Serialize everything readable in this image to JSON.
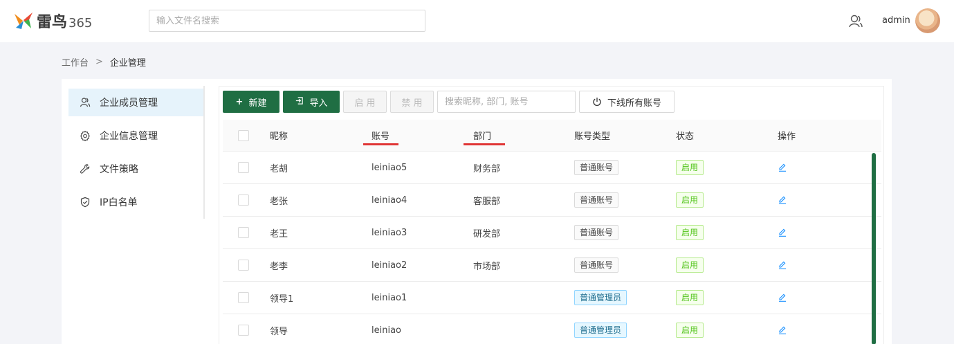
{
  "header": {
    "logo_text": "雷鸟",
    "logo_num": "365",
    "search_placeholder": "输入文件名搜索",
    "username": "admin"
  },
  "breadcrumb": {
    "home": "工作台",
    "separator": ">",
    "current": "企业管理"
  },
  "sidebar": {
    "items": [
      {
        "label": "企业成员管理",
        "icon": "users-icon",
        "active": true
      },
      {
        "label": "企业信息管理",
        "icon": "gear-icon",
        "active": false
      },
      {
        "label": "文件策略",
        "icon": "wrench-icon",
        "active": false
      },
      {
        "label": "IP白名单",
        "icon": "shield-icon",
        "active": false
      }
    ]
  },
  "toolbar": {
    "new_label": "新建",
    "new_icon": "plus-icon",
    "import_label": "导入",
    "import_icon": "import-icon",
    "enable_label": "启 用",
    "disable_label": "禁 用",
    "search_placeholder": "搜索昵称, 部门, 账号",
    "offline_label": "下线所有账号",
    "offline_icon": "power-icon"
  },
  "table": {
    "headers": {
      "nickname": "昵称",
      "account": "账号",
      "department": "部门",
      "account_type": "账号类型",
      "status": "状态",
      "action": "操作"
    },
    "rows": [
      {
        "nickname": "老胡",
        "account": "leiniao5",
        "department": "财务部",
        "account_type": "普通账号",
        "status": "启用"
      },
      {
        "nickname": "老张",
        "account": "leiniao4",
        "department": "客服部",
        "account_type": "普通账号",
        "status": "启用"
      },
      {
        "nickname": "老王",
        "account": "leiniao3",
        "department": "研发部",
        "account_type": "普通账号",
        "status": "启用"
      },
      {
        "nickname": "老李",
        "account": "leiniao2",
        "department": "市场部",
        "account_type": "普通账号",
        "status": "启用"
      },
      {
        "nickname": "领导1",
        "account": "leiniao1",
        "department": "",
        "account_type": "普通管理员",
        "status": "启用"
      },
      {
        "nickname": "领导",
        "account": "leiniao",
        "department": "",
        "account_type": "普通管理员",
        "status": "启用"
      }
    ]
  },
  "colors": {
    "primary": "#1f6e43",
    "highlight_underline": "#e03434",
    "status_green": "#52c41a",
    "sidebar_active_bg": "#e6f3fb"
  }
}
